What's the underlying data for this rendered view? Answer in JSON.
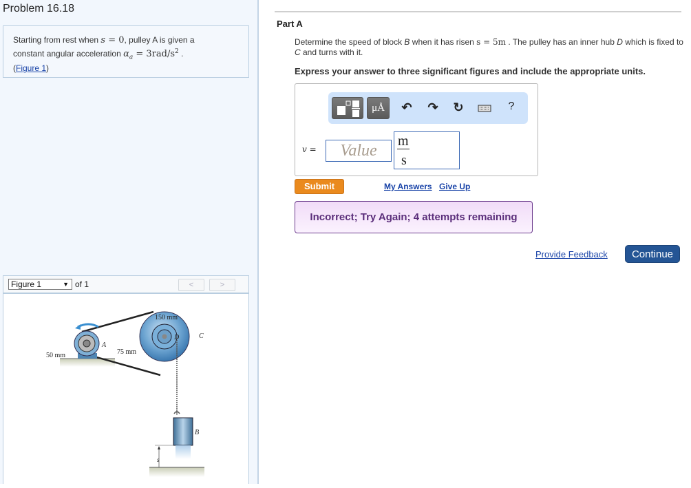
{
  "problem": {
    "title": "Problem 16.18",
    "statement": {
      "text_1": "Starting from rest when ",
      "math_s": "s",
      "math_eq0": " = 0",
      "text_2": ", pulley A is given a",
      "text_3": "constant angular acceleration ",
      "math_alpha": "α",
      "math_alpha_sub": "a",
      "math_value": " = 3rad/s",
      "math_exp": "2",
      "text_4": " .",
      "figure_link_open": "(",
      "figure_link": "Figure 1",
      "figure_link_close": ")"
    }
  },
  "figure_viewer": {
    "selected": "Figure 1",
    "of_label": "of 1",
    "prev": "<",
    "next": ">",
    "labels": {
      "outer_radius": "150 mm",
      "inner_radius": "75 mm",
      "motor_radius": "50 mm",
      "pulley_a": "A",
      "hub_d": "D",
      "pulley_c": "C",
      "block_b": "B",
      "displacement": "s"
    }
  },
  "part_a": {
    "title": "Part A",
    "question_1": "Determine the speed of block ",
    "question_b": "B",
    "question_2": " when it has risen ",
    "question_math": "s = 5m",
    "question_3": " . The pulley has an inner hub ",
    "question_d": "D",
    "question_4": " which is fixed to ",
    "question_c": "C",
    "question_5": " and turns with it.",
    "instruction": "Express your answer to three significant figures and include the appropriate units.",
    "toolbar": {
      "templates": "templates-icon",
      "units_label": "μÅ",
      "undo": "↶",
      "redo": "↷",
      "reset": "↻",
      "keyboard": "keyboard-icon",
      "help": "?"
    },
    "variable_label": "v =",
    "value_placeholder": "Value",
    "unit_numerator": "m",
    "unit_denominator": "s",
    "submit_label": "Submit",
    "my_answers_label": "My Answers",
    "give_up_label": "Give Up",
    "feedback_message": "Incorrect; Try Again; 4 attempts remaining"
  },
  "footer": {
    "provide_feedback": "Provide Feedback",
    "continue_label": "Continue"
  }
}
